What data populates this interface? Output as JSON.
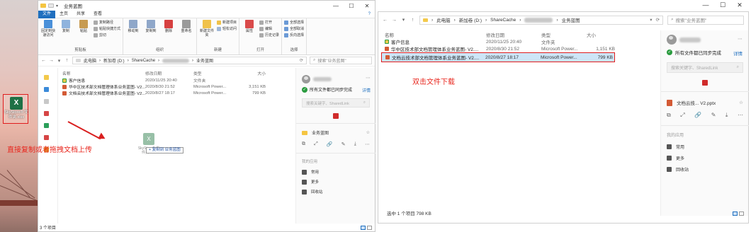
{
  "desktop": {
    "file_icon_caption": "SkyStore® 文件夹.xlsx",
    "drag_instruction": "直接复制或者拖拽文档上传"
  },
  "win1": {
    "title": "业务蓝图",
    "ribbon_tabs": [
      "文件",
      "主页",
      "共享",
      "查看"
    ],
    "clipboard": {
      "pin": "固定到快速访问",
      "copy": "复制",
      "paste": "粘贴",
      "copy_path": "复制路径",
      "paste_shortcut": "粘贴快捷方式",
      "cut": "剪切",
      "group": "剪贴板"
    },
    "organize": {
      "move_to": "移动到",
      "copy_to": "复制到",
      "delete": "删除",
      "rename": "重命名",
      "group": "组织"
    },
    "new": {
      "new_folder": "新建文件夹",
      "new_item": "新建项目",
      "easy_access": "轻松访问",
      "group": "新建"
    },
    "open": {
      "properties": "属性",
      "open": "打开",
      "edit": "编辑",
      "history": "历史记录",
      "group": "打开"
    },
    "select": {
      "select_all": "全部选择",
      "select_none": "全部取消",
      "invert": "反向选择",
      "group": "选择"
    },
    "address_parts": [
      "此电脑",
      "新加卷 (D:)",
      "ShareCache",
      "业务蓝图"
    ],
    "search_placeholder": "搜索\"业务蓝图\"",
    "columns": [
      "名称",
      "修改日期",
      "类型",
      "大小"
    ],
    "files": [
      {
        "name": "客户信息",
        "date": "2020/11/25 20:40",
        "type": "文件夹",
        "size": ""
      },
      {
        "name": "华中区技术部文档管理体系业务蓝图- V2....",
        "date": "2020/8/30 21:52",
        "type": "Microsoft Power...",
        "size": "3,151 KB"
      },
      {
        "name": "文档云技术部文档管理体系业务蓝图- V2....",
        "date": "2020/8/27 18:17",
        "type": "Microsoft Power...",
        "size": "799 KB"
      }
    ],
    "drag_tooltip": "+ 复制到 业务蓝图",
    "drag_ghost_caption": "SkyStore® 文件夹.xlsx",
    "status": "3 个项目",
    "sync_pane": {
      "all_synced": "所有文件都已同步完成",
      "details": "详情",
      "search_placeholder": "搜索关键字、SharedLink",
      "folder_name": "业务蓝图",
      "my_apps": "我的应用",
      "apps": [
        "常用",
        "更多",
        "回收站"
      ]
    }
  },
  "win2": {
    "address_parts": [
      "此电脑",
      "新加卷 (D:)",
      "ShareCache",
      "业务蓝图"
    ],
    "search_placeholder": "搜索\"业务蓝图\"",
    "columns": [
      "名称",
      "修改日期",
      "类型",
      "大小"
    ],
    "files": [
      {
        "name": "客户信息",
        "date": "2020/11/25 20:40",
        "type": "文件夹",
        "size": ""
      },
      {
        "name": "华中区技术部文档管理体系业务蓝图- V2....",
        "date": "2020/8/30 21:52",
        "type": "Microsoft Power...",
        "size": "1,151 KB"
      },
      {
        "name": "文档云技术部文档管理体系业务蓝图- V2....",
        "date": "2020/8/27 18:17",
        "type": "Microsoft Power...",
        "size": "799 KB"
      }
    ],
    "annotation": "双击文件下载",
    "status": "选中 1 个项目  798 KB",
    "sync_pane": {
      "all_synced": "所有文件都已同步完成",
      "details": "详情",
      "search_placeholder": "搜索关键字、SharedLink",
      "file_name": "文档云技... V2.pptx",
      "my_apps": "我的应用",
      "apps": [
        "常用",
        "更多",
        "回收站"
      ]
    }
  }
}
